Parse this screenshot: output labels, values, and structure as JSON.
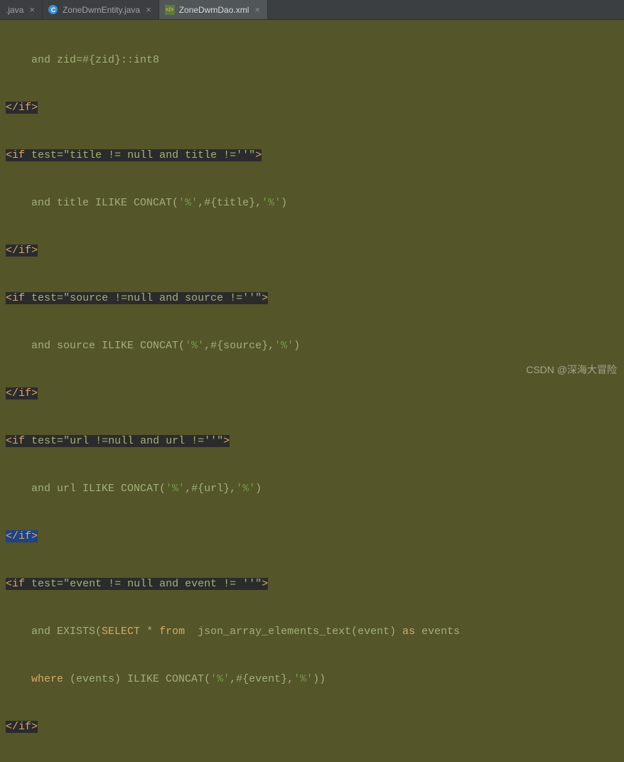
{
  "tabs": [
    {
      "label": ".java",
      "icon": "none",
      "active": false
    },
    {
      "label": "ZoneDwmEntity.java",
      "icon": "class",
      "active": false
    },
    {
      "label": "ZoneDwmDao.xml",
      "icon": "xml",
      "active": true
    }
  ],
  "code": {
    "l1_indent": "    ",
    "l1_a": "and zid=#{zid}::int8",
    "l2": "</if>",
    "l3_open": "<if",
    "l3_attr": "test",
    "l3_val": "\"title != null and title !=''\"",
    "l3_close": ">",
    "l4_a": "and title ILIKE CONCAT(",
    "l4_s1": "'%'",
    "l4_b": ",#{title},",
    "l4_s2": "'%'",
    "l4_c": ")",
    "l5": "</if>",
    "l6_open": "<if",
    "l6_attr": "test",
    "l6_val": "\"source !=null and source !=''\"",
    "l6_close": ">",
    "l7_a": "and source ILIKE CONCAT(",
    "l7_s1": "'%'",
    "l7_b": ",#{source},",
    "l7_s2": "'%'",
    "l7_c": ")",
    "l8": "</if>",
    "l9_open": "<if",
    "l9_attr": "test",
    "l9_val": "\"url !=null and url !=''\"",
    "l9_close": ">",
    "l10_a": "and url ILIKE CONCAT(",
    "l10_s1": "'%'",
    "l10_b": ",#{url},",
    "l10_s2": "'%'",
    "l10_c": ")",
    "l11": "</if>",
    "l12_open": "<if",
    "l12_attr": "test",
    "l12_val": "\"event != null and event != ''\"",
    "l12_close": ">",
    "l13_a": "and EXISTS(",
    "l13_kw1": "SELECT",
    "l13_b": " * ",
    "l13_kw2": "from",
    "l13_c": "  json_array_elements_text(event) ",
    "l13_kw3": "as",
    "l13_d": " events",
    "l14_a": "where",
    "l14_b": " (events) ILIKE CONCAT(",
    "l14_s1": "'%'",
    "l14_c": ",#{event},",
    "l14_s2": "'%'",
    "l14_d": "))",
    "l15": "</if>"
  },
  "watermark": "CSDN @深海大冒险"
}
